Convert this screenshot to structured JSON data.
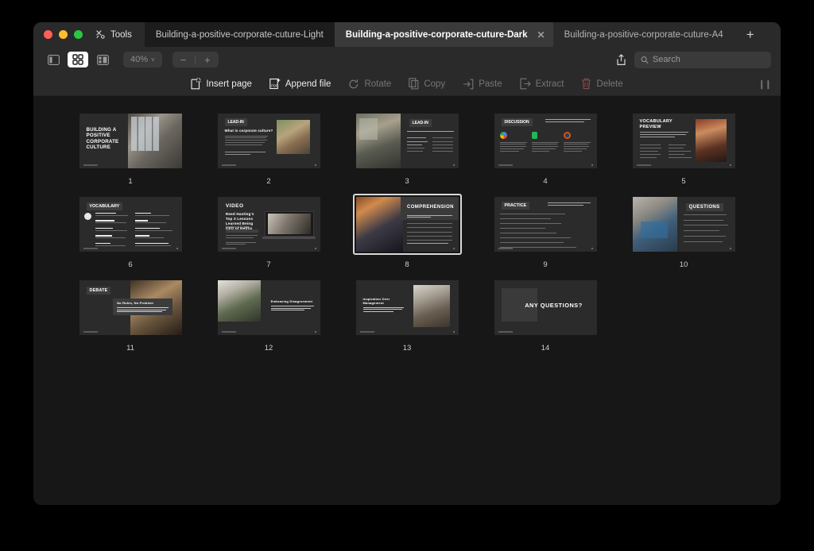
{
  "window": {
    "traffic_lights": [
      "close",
      "minimize",
      "maximize"
    ],
    "tools_label": "Tools",
    "tabs": [
      {
        "label": "Building-a-positive-corporate-cuture-Light",
        "active": false,
        "closable": false
      },
      {
        "label": "Building-a-positive-corporate-cuture-Dark",
        "active": true,
        "closable": true
      },
      {
        "label": "Building-a-positive-corporate-cuture-A4",
        "active": false,
        "closable": false
      }
    ],
    "add_tab_label": "+"
  },
  "toolbar": {
    "view_sidebar_icon": "sidebar-icon",
    "view_grid_icon": "grid-icon",
    "view_split_icon": "split-view-icon",
    "zoom_level": "40%",
    "zoom_chevron": "˅",
    "zoom_out_label": "−",
    "zoom_sep_label": "|",
    "zoom_in_label": "+",
    "share_icon": "share-icon",
    "search_placeholder": "Search",
    "search_value": ""
  },
  "actions": [
    {
      "label": "Insert page",
      "icon": "insert-page-icon",
      "enabled": true
    },
    {
      "label": "Append file",
      "icon": "append-file-icon",
      "enabled": true
    },
    {
      "label": "Rotate",
      "icon": "rotate-icon",
      "enabled": false
    },
    {
      "label": "Copy",
      "icon": "copy-icon",
      "enabled": false
    },
    {
      "label": "Paste",
      "icon": "paste-icon",
      "enabled": false
    },
    {
      "label": "Extract",
      "icon": "extract-icon",
      "enabled": false
    },
    {
      "label": "Delete",
      "icon": "trash-icon",
      "enabled": false
    }
  ],
  "pages": [
    {
      "number": "1",
      "selected": false,
      "kind": "title",
      "title": "BUILDING A POSITIVE CORPORATE CULTURE"
    },
    {
      "number": "2",
      "selected": false,
      "kind": "lead-in-left",
      "badge": "LEAD-IN",
      "heading": "What is corporate culture?"
    },
    {
      "number": "3",
      "selected": false,
      "kind": "lead-in-right",
      "badge": "LEAD-IN",
      "heading": "Brainstorm characteristics of a positive corporate culture",
      "bullets": [
        "Support for Growth",
        "Open and Receptive",
        "Friendly"
      ]
    },
    {
      "number": "4",
      "selected": false,
      "kind": "discussion",
      "badge": "DISCUSSION",
      "heading": "Explore these innovative corporate culture methods used by famous companies and share your thoughts.",
      "columns": [
        "Google",
        "Spotify",
        "Patagonia"
      ]
    },
    {
      "number": "5",
      "selected": false,
      "kind": "vocab-preview",
      "title": "VOCABULARY PREVIEW",
      "heading": "Here is a list of key new words for the words you're familiar with. Then, discuss the unfamiliar words on the next page."
    },
    {
      "number": "6",
      "selected": false,
      "kind": "vocabulary",
      "badge": "VOCABULARY",
      "terms_left": [
        "vacation policy",
        "expense policy",
        "appropriation",
        "global culture",
        "nepotism"
      ],
      "terms_right": [
        "allocation",
        "logistics",
        "open disagreement",
        "overdue",
        "act in the interest of best interest"
      ]
    },
    {
      "number": "7",
      "selected": false,
      "kind": "video",
      "title": "VIDEO",
      "heading": "Reed Hasting's Top 3 Lessons Learned Being CEO of Netflix",
      "duration": "Duration: 4:47 min"
    },
    {
      "number": "8",
      "selected": true,
      "kind": "comprehension",
      "title": "COMPREHENSION",
      "heading": "What lessons did Reed Hastings learn while being CEO of Netflix?",
      "question": "Which of the lessons resonates with you the most?"
    },
    {
      "number": "9",
      "selected": false,
      "kind": "practice",
      "badge": "PRACTICE",
      "heading": "Use these the first part of a sentence. Make it longer and more detailed by using the suggested keywords."
    },
    {
      "number": "10",
      "selected": false,
      "kind": "questions",
      "title": "QUESTIONS"
    },
    {
      "number": "11",
      "selected": false,
      "kind": "debate",
      "badge": "DEBATE",
      "card_title": "No Rules, No Problem",
      "card_body": "Companies should adopt a 'no rules' approach to policies like vacation and expenses to empower employees and stimulate innovation."
    },
    {
      "number": "12",
      "selected": false,
      "kind": "concept-right",
      "card_title": "Embracing Disagreement",
      "card_body": "Encouraging open disagreement within a company leads to better decision-making and prevents costly mistakes."
    },
    {
      "number": "13",
      "selected": false,
      "kind": "concept-left",
      "card_title": "Inspiration Over Management",
      "card_body": "Leaders should focus on inspiring their teams rather than managing them, as this fosters creativity and drives high performance."
    },
    {
      "number": "14",
      "selected": false,
      "kind": "any-questions",
      "title": "ANY QUESTIONS?"
    }
  ]
}
